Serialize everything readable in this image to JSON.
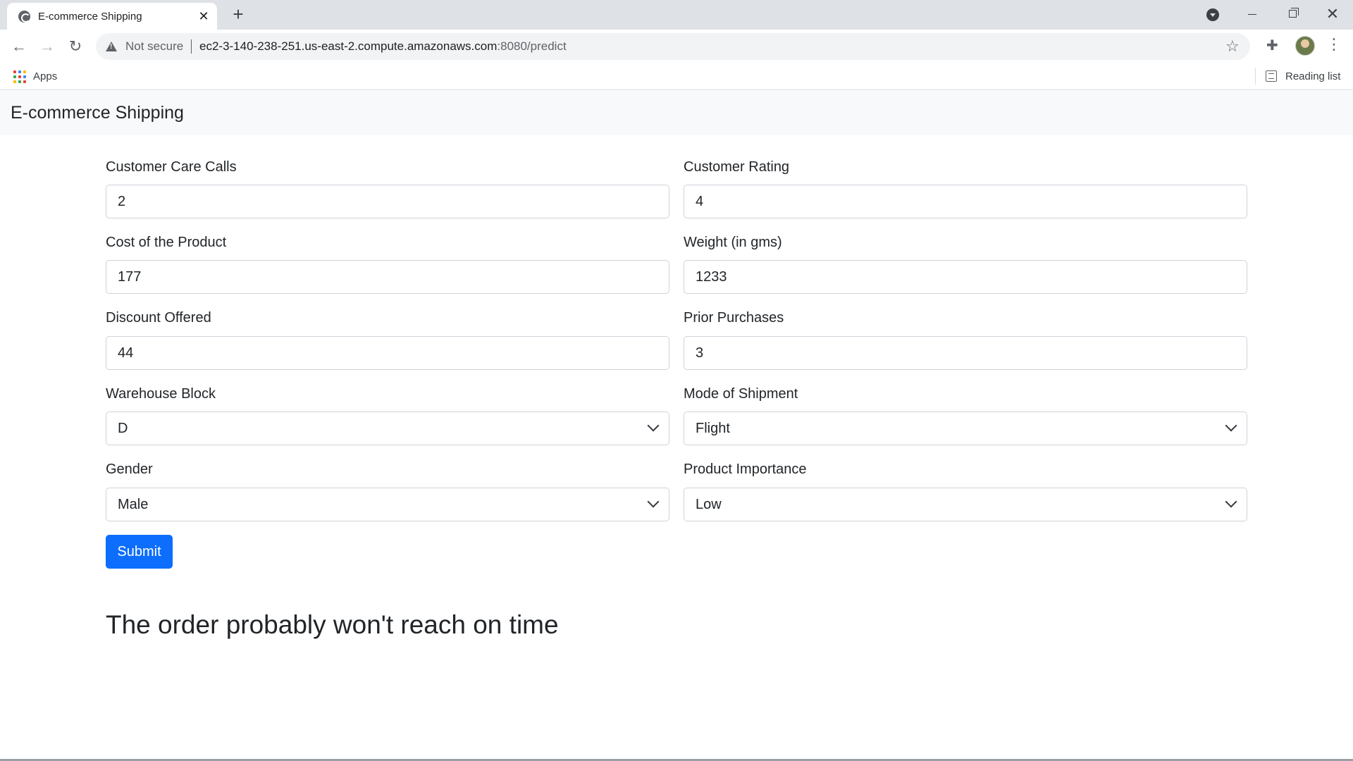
{
  "browser": {
    "tab_title": "E-commerce Shipping",
    "address": {
      "security_label": "Not secure",
      "url_host": "ec2-3-140-238-251.us-east-2.compute.amazonaws.com",
      "url_path": ":8080/predict"
    },
    "bookmarks": {
      "apps_label": "Apps",
      "reading_list_label": "Reading list"
    }
  },
  "navbar": {
    "brand": "E-commerce Shipping"
  },
  "form": {
    "customer_care_calls": {
      "label": "Customer Care Calls",
      "value": "2"
    },
    "customer_rating": {
      "label": "Customer Rating",
      "value": "4"
    },
    "cost_of_product": {
      "label": "Cost of the Product",
      "value": "177"
    },
    "weight": {
      "label": "Weight (in gms)",
      "value": "1233"
    },
    "discount_offered": {
      "label": "Discount Offered",
      "value": "44"
    },
    "prior_purchases": {
      "label": "Prior Purchases",
      "value": "3"
    },
    "warehouse_block": {
      "label": "Warehouse Block",
      "selected": "D"
    },
    "mode_of_shipment": {
      "label": "Mode of Shipment",
      "selected": "Flight"
    },
    "gender": {
      "label": "Gender",
      "selected": "Male"
    },
    "product_importance": {
      "label": "Product Importance",
      "selected": "Low"
    },
    "submit_label": "Submit"
  },
  "result": {
    "message": "The order probably won't reach on time"
  },
  "colors": {
    "primary": "#0d6efd",
    "navbar_bg": "#f8f9fa",
    "tabbar_bg": "#dee1e6"
  }
}
